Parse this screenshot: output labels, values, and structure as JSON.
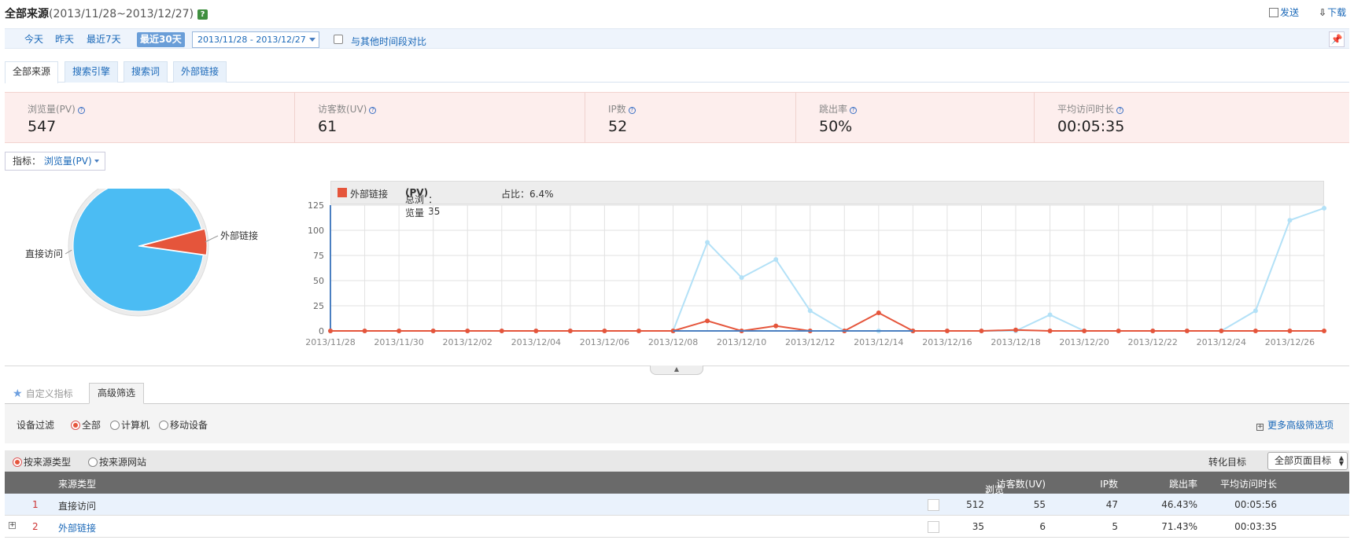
{
  "header": {
    "title": "全部来源",
    "date_range": "(2013/11/28~2013/12/27)",
    "help": "?",
    "send": "发送",
    "download": "下载"
  },
  "datebar": {
    "today": "今天",
    "yesterday": "昨天",
    "last7": "最近7天",
    "last30": "最近30天",
    "range": "2013/11/28 - 2013/12/27",
    "compare": "与其他时间段对比"
  },
  "tabs": [
    "全部来源",
    "搜索引擎",
    "搜索词",
    "外部链接"
  ],
  "summary": [
    {
      "label": "浏览量(PV)",
      "value": "547"
    },
    {
      "label": "访客数(UV)",
      "value": "61"
    },
    {
      "label": "IP数",
      "value": "52"
    },
    {
      "label": "跳出率",
      "value": "50%"
    },
    {
      "label": "平均访问时长",
      "value": "00:05:35"
    }
  ],
  "metric_selector": {
    "label": "指标：",
    "value": "浏览量(PV)"
  },
  "pie": {
    "labels": [
      "外部链接",
      "直接访问"
    ],
    "values": [
      35,
      512
    ],
    "colors": [
      "#e5553b",
      "#4bbcf3"
    ]
  },
  "legend": {
    "series": "外部链接",
    "total_label": "总浏览量",
    "total_metric": "(PV)",
    "total_value": "：35",
    "share": "占比：6.4%"
  },
  "chart_data": {
    "type": "line",
    "x": [
      "2013/11/28",
      "2013/11/29",
      "2013/11/30",
      "2013/12/01",
      "2013/12/02",
      "2013/12/03",
      "2013/12/04",
      "2013/12/05",
      "2013/12/06",
      "2013/12/07",
      "2013/12/08",
      "2013/12/09",
      "2013/12/10",
      "2013/12/11",
      "2013/12/12",
      "2013/12/13",
      "2013/12/14",
      "2013/12/15",
      "2013/12/16",
      "2013/12/17",
      "2013/12/18",
      "2013/12/19",
      "2013/12/20",
      "2013/12/21",
      "2013/12/22",
      "2013/12/23",
      "2013/12/24",
      "2013/12/25",
      "2013/12/26",
      "2013/12/27"
    ],
    "xticks": [
      "2013/11/28",
      "2013/11/30",
      "2013/12/02",
      "2013/12/04",
      "2013/12/06",
      "2013/12/08",
      "2013/12/10",
      "2013/12/12",
      "2013/12/14",
      "2013/12/16",
      "2013/12/18",
      "2013/12/20",
      "2013/12/22",
      "2013/12/24",
      "2013/12/26"
    ],
    "yticks": [
      0,
      25,
      50,
      75,
      100,
      125
    ],
    "ylim": [
      0,
      125
    ],
    "series": [
      {
        "name": "直接访问",
        "color": "#b3e1f7",
        "values": [
          0,
          0,
          0,
          0,
          0,
          0,
          0,
          0,
          0,
          0,
          0,
          88,
          53,
          71,
          20,
          0,
          0,
          0,
          0,
          0,
          0,
          16,
          0,
          0,
          0,
          0,
          0,
          20,
          110,
          122
        ]
      },
      {
        "name": "外部链接",
        "color": "#e5553b",
        "values": [
          0,
          0,
          0,
          0,
          0,
          0,
          0,
          0,
          0,
          0,
          0,
          10,
          0,
          5,
          0,
          0,
          18,
          0,
          0,
          0,
          1,
          0,
          0,
          0,
          0,
          0,
          0,
          0,
          0,
          0
        ]
      }
    ]
  },
  "lower_tabs": {
    "custom": "自定义指标",
    "advanced": "高级筛选"
  },
  "filter": {
    "label": "设备过滤",
    "options": [
      "全部",
      "计算机",
      "移动设备"
    ],
    "more": "更多高级筛选项"
  },
  "source_bar": {
    "by_type": "按来源类型",
    "by_site": "按来源网站",
    "conv_label": "转化目标",
    "conv_value": "全部页面目标"
  },
  "table": {
    "headers": {
      "type": "来源类型",
      "pv": "浏览量(PV)",
      "uv": "访客数(UV)",
      "ip": "IP数",
      "bounce": "跳出率",
      "avg": "平均访问时长"
    },
    "rows": [
      {
        "rank": "1",
        "name": "直接访问",
        "pv": "512",
        "uv": "55",
        "ip": "47",
        "bounce": "46.43%",
        "avg": "00:05:56"
      },
      {
        "rank": "2",
        "name": "外部链接",
        "pv": "35",
        "uv": "6",
        "ip": "5",
        "bounce": "71.43%",
        "avg": "00:03:35"
      }
    ]
  }
}
